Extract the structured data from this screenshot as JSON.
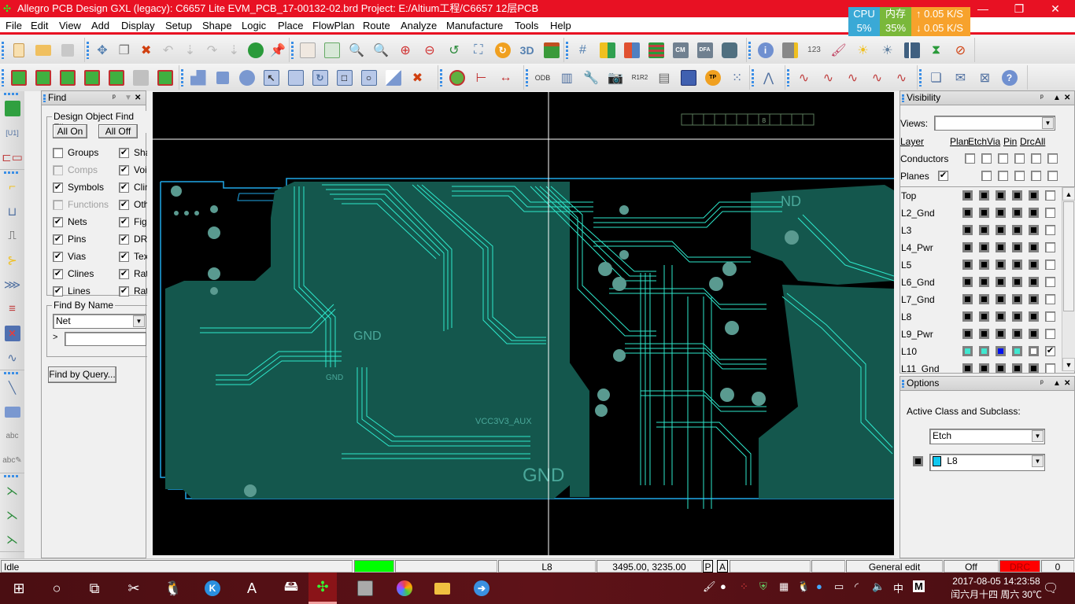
{
  "window": {
    "title": "Allegro PCB Design GXL (legacy): C6657 Lite EVM_PCB_17-00132-02.brd  Project: E:/Altium工程/C6657 12层PCB",
    "minimize": "—",
    "restore": "❐",
    "close": "✕",
    "brand": "cadence"
  },
  "sysmon": {
    "cpu_label": "CPU",
    "cpu_value": "5%",
    "mem_label": "内存",
    "mem_value": "35%",
    "upload": "↑  0.05 K/S",
    "download": "↓  0.05 K/S"
  },
  "menu": [
    "File",
    "Edit",
    "View",
    "Add",
    "Display",
    "Setup",
    "Shape",
    "Logic",
    "Place",
    "FlowPlan",
    "Route",
    "Analyze",
    "Manufacture",
    "Tools",
    "Help"
  ],
  "toolbar1": {
    "groups": [
      [
        "new-file",
        "open-folder",
        "save"
      ],
      [
        "move",
        "copy",
        "delete",
        "undo",
        "step-down",
        "redo",
        "step-down-2",
        "shape-edit",
        "pin-push"
      ],
      [
        "grid-toggle",
        "ratsnest",
        "zoom-fit",
        "zoom-window",
        "zoom-in",
        "zoom-out",
        "zoom-previous",
        "zoom-world",
        "redraw",
        "3d-view",
        "flip-board"
      ],
      [
        "grid-settings",
        "color-dialog",
        "layer-visibility",
        "layer-stackup",
        "constraint-manager",
        "dfa-browser",
        "global-view"
      ],
      [
        "info",
        "element-info",
        "measure",
        "clean",
        "highlight",
        "dehighlight",
        "status",
        "hourglass",
        "no-select"
      ]
    ]
  },
  "toolbar2": {
    "groups": [
      [
        "place-manual",
        "place-quickplace",
        "route-connect",
        "fanout",
        "autoroute",
        "disabled-tool",
        "shape-add"
      ],
      [
        "shape-polygon",
        "shape-rect",
        "shape-circle",
        "shape-select",
        "shape-merge",
        "shape-void",
        "shape-rect-void",
        "shape-circle-void",
        "shape-manual-void",
        "shape-delete-void"
      ],
      [
        "component-assign",
        "dimension-linear",
        "dimension-datum"
      ],
      [
        "odb-export",
        "artwork",
        "tools-padstack",
        "snapshot",
        "ref-des",
        "padstack-list",
        "panel-matrix",
        "test-point",
        "array"
      ],
      [
        "via-structure"
      ],
      [
        "sigx-report",
        "sigx-book",
        "sigx-probe",
        "sigx-checklist",
        "sigx-wiring"
      ],
      [
        "documents",
        "mail",
        "window-manager",
        "help"
      ]
    ]
  },
  "leftbar": {
    "groups": [
      [
        "place-component",
        "unplaced-symbol",
        "connect-part"
      ],
      [
        "add-connect",
        "slide",
        "delay-tune",
        "custom-smooth",
        "spread",
        "bundle",
        "grouping",
        "phase-tune"
      ],
      [
        "add-line",
        "add-rect",
        "add-text",
        "edit-text"
      ],
      [
        "add-flowline",
        "flowline-edit",
        "flowline-delete"
      ]
    ]
  },
  "find": {
    "title": "Find",
    "filter_legend": "Design Object Find Filter",
    "all_on": "All On",
    "all_off": "All Off",
    "left_items": [
      {
        "label": "Groups",
        "checked": false,
        "disabled": false
      },
      {
        "label": "Comps",
        "checked": false,
        "disabled": true
      },
      {
        "label": "Symbols",
        "checked": true,
        "disabled": false
      },
      {
        "label": "Functions",
        "checked": false,
        "disabled": true
      },
      {
        "label": "Nets",
        "checked": true,
        "disabled": false
      },
      {
        "label": "Pins",
        "checked": true,
        "disabled": false
      },
      {
        "label": "Vias",
        "checked": true,
        "disabled": false
      },
      {
        "label": "Clines",
        "checked": true,
        "disabled": false
      },
      {
        "label": "Lines",
        "checked": true,
        "disabled": false
      }
    ],
    "right_items": [
      {
        "label": "Shapes",
        "checked": true
      },
      {
        "label": "Voids",
        "checked": true
      },
      {
        "label": "Cline segs",
        "checked": true
      },
      {
        "label": "Other segs",
        "checked": true
      },
      {
        "label": "Figures",
        "checked": true
      },
      {
        "label": "DRC errors",
        "checked": true
      },
      {
        "label": "Text",
        "checked": true
      },
      {
        "label": "Ratsnests",
        "checked": true
      },
      {
        "label": "Rat Ts",
        "checked": true
      }
    ],
    "by_name_legend": "Find By Name",
    "by_name_type": "Net",
    "name_prompt": ">",
    "name_value": "",
    "query_button": "Find by Query..."
  },
  "canvas": {
    "board_labels": [
      "GND",
      "GND",
      "GND",
      "VCC3V3_AUX",
      "GND",
      "ND"
    ],
    "layer_readout": "8",
    "colors": {
      "board": "#14574d",
      "trace": "#2ee8cc",
      "outline": "#20a8e8",
      "background": "#000000"
    }
  },
  "visibility": {
    "title": "Visibility",
    "views_label": "Views:",
    "views_value": "",
    "columns": [
      "Layer",
      "Plan",
      "Etch",
      "Via",
      "Pin",
      "Drc",
      "All"
    ],
    "conductors_label": "Conductors",
    "planes_label": "Planes",
    "conductors_checks": [
      false,
      false,
      false,
      false,
      false,
      false
    ],
    "planes_checks": [
      true,
      false,
      false,
      false,
      false,
      false
    ],
    "layers": [
      {
        "name": "Top",
        "colors": [
          "#000000",
          "#000000",
          "#000000",
          "#000000",
          "#000000"
        ],
        "all": false
      },
      {
        "name": "L2_Gnd",
        "colors": [
          "#000000",
          "#000000",
          "#000000",
          "#000000",
          "#000000"
        ],
        "all": false
      },
      {
        "name": "L3",
        "colors": [
          "#000000",
          "#000000",
          "#000000",
          "#000000",
          "#000000"
        ],
        "all": false
      },
      {
        "name": "L4_Pwr",
        "colors": [
          "#000000",
          "#000000",
          "#000000",
          "#000000",
          "#000000"
        ],
        "all": false
      },
      {
        "name": "L5",
        "colors": [
          "#000000",
          "#000000",
          "#000000",
          "#000000",
          "#000000"
        ],
        "all": false
      },
      {
        "name": "L6_Gnd",
        "colors": [
          "#000000",
          "#000000",
          "#000000",
          "#000000",
          "#000000"
        ],
        "all": false
      },
      {
        "name": "L7_Gnd",
        "colors": [
          "#000000",
          "#000000",
          "#000000",
          "#000000",
          "#000000"
        ],
        "all": false
      },
      {
        "name": "L8",
        "colors": [
          "#000000",
          "#000000",
          "#000000",
          "#000000",
          "#000000"
        ],
        "all": false
      },
      {
        "name": "L9_Pwr",
        "colors": [
          "#000000",
          "#000000",
          "#000000",
          "#000000",
          "#000000"
        ],
        "all": false
      },
      {
        "name": "L10",
        "colors": [
          "#40e8d0",
          "#40e8d0",
          "#0010f0",
          "#40e8d0",
          "#ffffff"
        ],
        "all": true
      },
      {
        "name": "L11_Gnd",
        "colors": [
          "#000000",
          "#000000",
          "#000000",
          "#000000",
          "#000000"
        ],
        "all": false
      }
    ]
  },
  "options": {
    "title": "Options",
    "active_label": "Active Class and Subclass:",
    "class_value": "Etch",
    "subclass_value": "L8",
    "subclass_color": "#10c8f0"
  },
  "status": {
    "state": "Idle",
    "layer": "L8",
    "coords": "3495.00, 3235.00",
    "p": "P",
    "a": "A",
    "mode": "General edit",
    "off": "Off",
    "drc": "DRC",
    "drc_count": "0",
    "drc_color": "#ff0000",
    "progress_color": "#00ff00"
  },
  "taskbar": {
    "apps": [
      "start",
      "cortana",
      "task-view",
      "snipping-tool",
      "qq",
      "kugou",
      "allegro-17",
      "disk-manager",
      "allegro-pcb",
      "pcb-editor",
      "photos",
      "file-explorer",
      "sogou"
    ],
    "ime": "中",
    "ime2": "M",
    "date": "2017-08-05  14:23:58",
    "lunar": "闰六月十四 周六 30℃"
  }
}
